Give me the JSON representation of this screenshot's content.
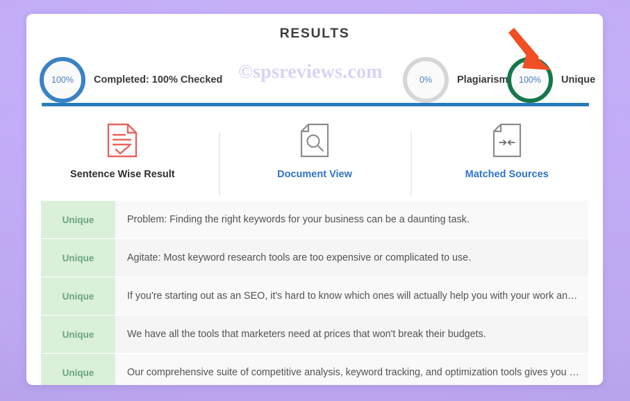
{
  "page": {
    "background_color": "#c3adf9",
    "card_background": "#ffffff"
  },
  "header": {
    "title": "RESULTS",
    "watermark": "©spsreviews.com",
    "divider_color": "#2a7cb8"
  },
  "stats": [
    {
      "name": "completed",
      "percent": "100%",
      "label": "Completed: 100% Checked",
      "ring_color": "#3a82c4",
      "percent_color": "#4a7fc1"
    },
    {
      "name": "plagiarism",
      "percent": "0%",
      "label": "Plagiarism",
      "ring_color": "#d6d6d6",
      "percent_color": "#4a7fc1"
    },
    {
      "name": "unique",
      "percent": "100%",
      "label": "Unique",
      "ring_color": "#14774a",
      "percent_color": "#4a7fc1"
    }
  ],
  "annotation": {
    "arrow_color": "#f04e23",
    "points_at": "unique"
  },
  "tabs": [
    {
      "label": "Sentence Wise Result",
      "icon": "document-lines-check-icon",
      "icon_color": "#e8635c",
      "state": "active"
    },
    {
      "label": "Document View",
      "icon": "document-search-icon",
      "icon_color": "#8d8d8d",
      "state": "link"
    },
    {
      "label": "Matched Sources",
      "icon": "document-arrows-icon",
      "icon_color": "#8d8d8d",
      "state": "link"
    }
  ],
  "results": {
    "verdict_label": "Unique",
    "verdict_bg": "#dbf0d9",
    "verdict_color": "#69a583",
    "rows": [
      {
        "verdict": "Unique",
        "sentence": "Problem: Finding the right keywords for your business can be a daunting task."
      },
      {
        "verdict": "Unique",
        "sentence": "Agitate: Most keyword research tools are too expensive or complicated to use."
      },
      {
        "verdict": "Unique",
        "sentence": "If you're starting out as an SEO, it's hard to know which ones will actually help you with your work an…"
      },
      {
        "verdict": "Unique",
        "sentence": "We have all the tools that marketers need at prices that won't break their budgets."
      },
      {
        "verdict": "Unique",
        "sentence": "Our comprehensive suite of competitive analysis, keyword tracking, and optimization tools gives you …"
      }
    ]
  }
}
